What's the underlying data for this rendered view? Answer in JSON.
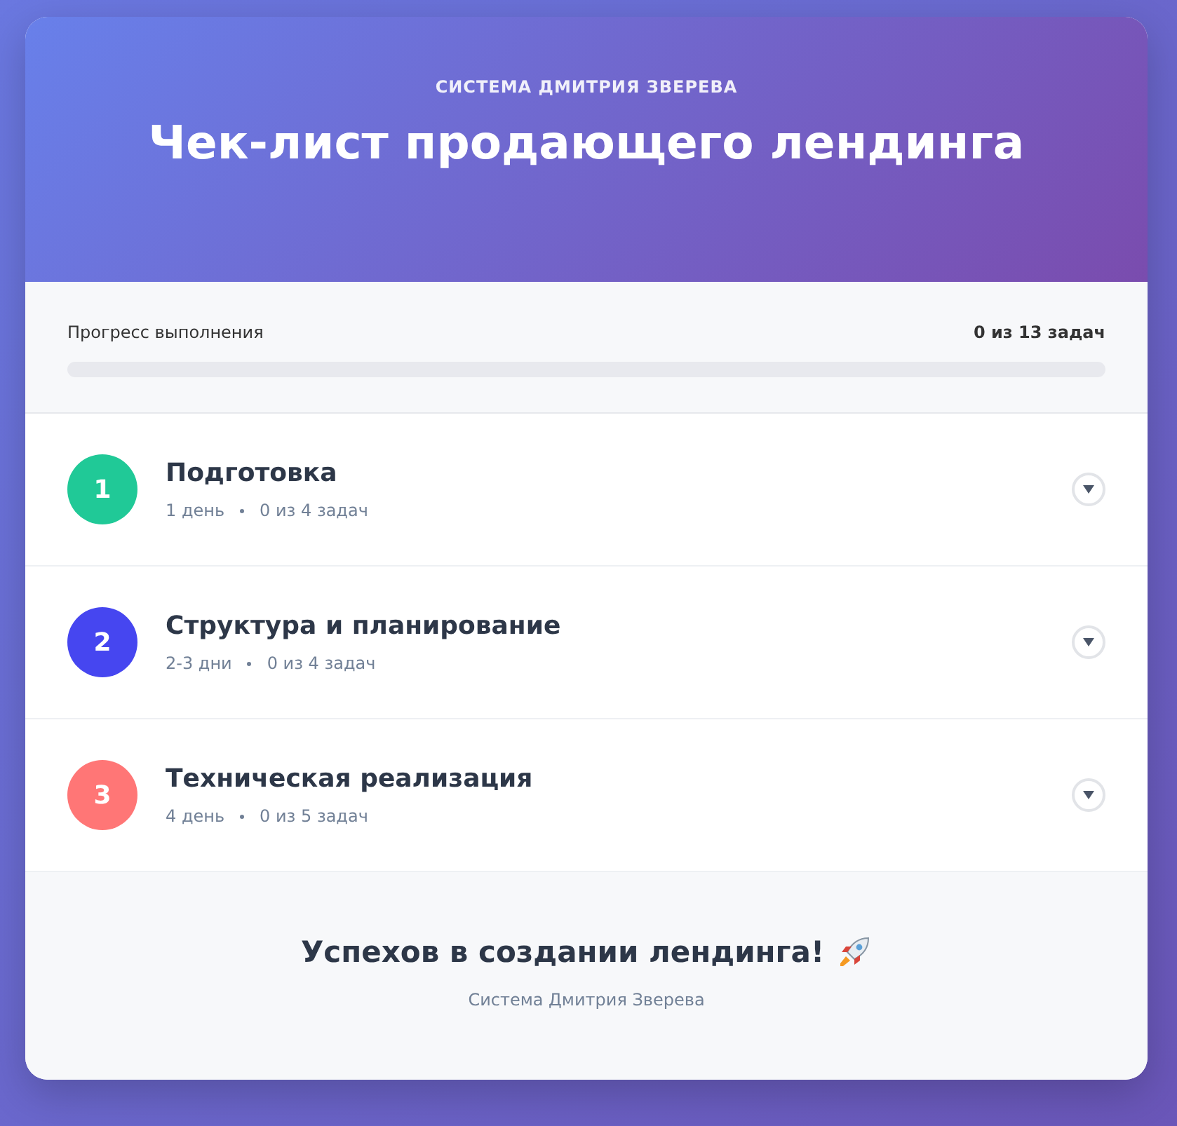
{
  "header": {
    "subtitle": "СИСТЕМА ДМИТРИЯ ЗВЕРЕВА",
    "title": "Чек-лист продающего лендинга"
  },
  "progress": {
    "label": "Прогресс выполнения",
    "count": "0 из 13 задач",
    "level": 0
  },
  "sections": [
    {
      "number": "1",
      "title": "Подготовка",
      "duration": "1 день",
      "tasks": "0 из 4 задач",
      "color": "#20c997",
      "expanded": false
    },
    {
      "number": "2",
      "title": "Структура и планирование",
      "duration": "2-3 дни",
      "tasks": "0 из 4 задач",
      "color": "#4646f0",
      "expanded": false
    },
    {
      "number": "3",
      "title": "Техническая реализация",
      "duration": "4 день",
      "tasks": "0 из 5 задач",
      "color": "#ff7676",
      "expanded": false
    }
  ],
  "footer": {
    "title": "Успехов в создании лендинга!",
    "signature": "Система Дмитрия Зверева"
  }
}
